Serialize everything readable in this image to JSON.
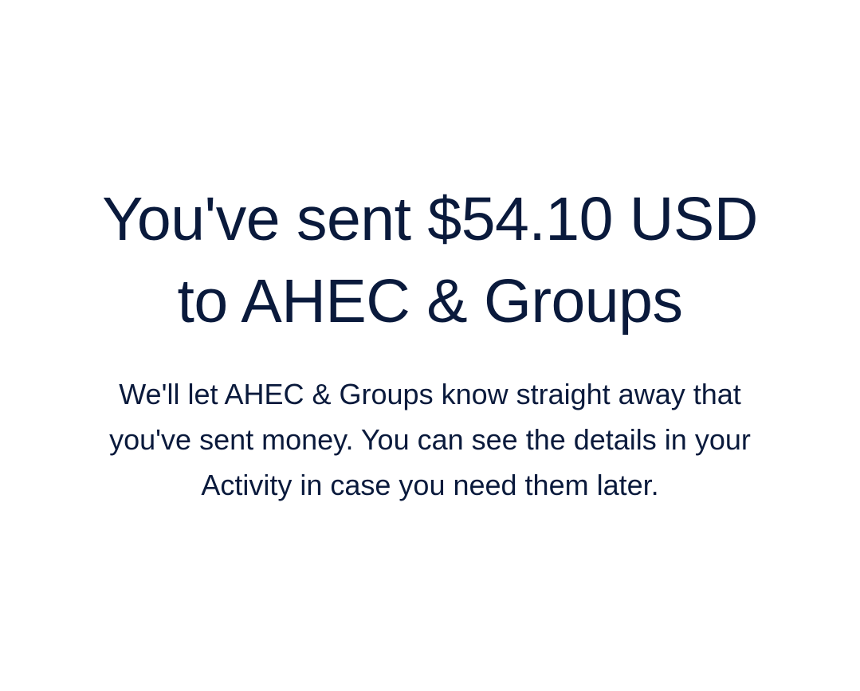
{
  "confirmation": {
    "headline_lines": [
      "You've sent $54.10 USD",
      "to AHEC & Groups"
    ],
    "message_lines": [
      "We'll let AHEC & Groups know straight away that",
      "you've sent money. You can see the details in your",
      "Activity in case you need them later."
    ]
  },
  "colors": {
    "text": "#0a1a3c",
    "background": "#ffffff"
  }
}
